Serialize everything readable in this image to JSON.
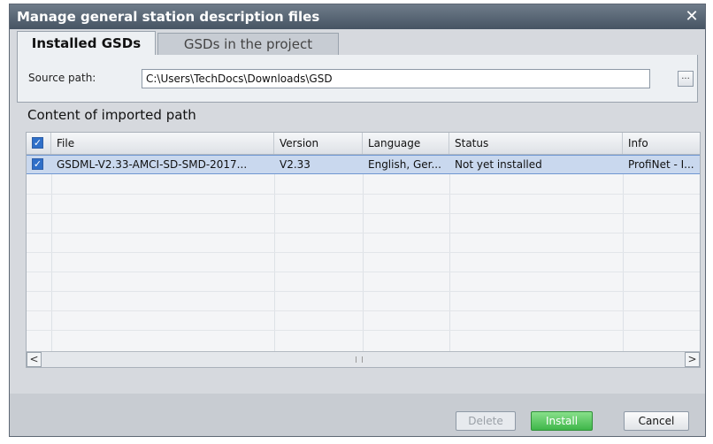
{
  "dialog": {
    "title": "Manage general station description files",
    "close_glyph": "✕",
    "tabs": [
      {
        "label": "Installed GSDs",
        "active": true
      },
      {
        "label": "GSDs in the project",
        "active": false
      }
    ],
    "source": {
      "label": "Source path:",
      "value": "C:\\Users\\TechDocs\\Downloads\\GSD",
      "browse_label": "..."
    },
    "section_title": "Content of imported path",
    "table": {
      "header_checked": true,
      "columns": [
        "File",
        "Version",
        "Language",
        "Status",
        "Info"
      ],
      "rows": [
        {
          "checked": true,
          "file": "GSDML-V2.33-AMCI-SD-SMD-2017...",
          "version": "V2.33",
          "language": "English, Ger...",
          "status": "Not yet installed",
          "info": "ProfiNet - I..."
        }
      ]
    },
    "scroll": {
      "left": "<",
      "right": ">"
    },
    "buttons": {
      "delete": "Delete",
      "install": "Install",
      "cancel": "Cancel"
    }
  },
  "colors": {
    "titlebar": "#465463",
    "selection": "#c9d8ee",
    "install": "#3fb64a"
  },
  "icons": [
    "close-icon",
    "checkbox-icon",
    "scroll-left-icon",
    "scroll-right-icon"
  ]
}
